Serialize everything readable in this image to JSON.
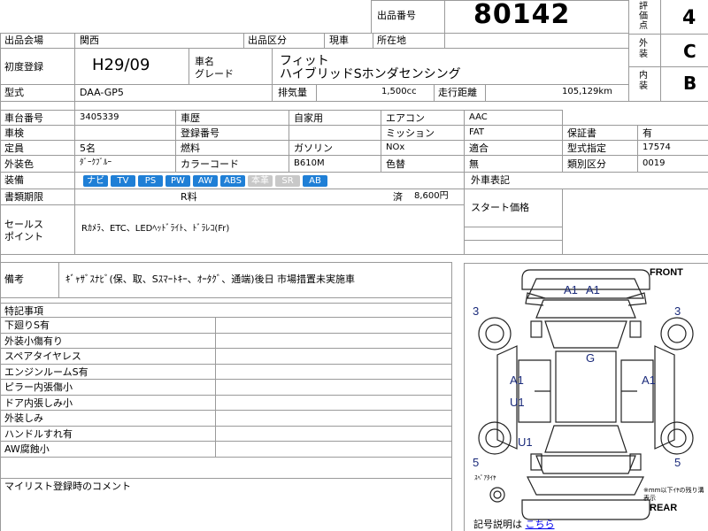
{
  "header": {
    "lot_label": "出品番号",
    "lot_number": "80142",
    "grade_label": "評価点",
    "grade": "4",
    "exterior_label": "外装",
    "exterior_grade": "C",
    "interior_label": "内装",
    "interior_grade": "B"
  },
  "row1": {
    "venue_label": "出品会場",
    "venue": "関西",
    "category_label": "出品区分",
    "category": "現車",
    "location_label": "所在地",
    "location": ""
  },
  "row2": {
    "first_reg_label": "初度登録",
    "first_reg": "H29/09",
    "name_label_1": "車名",
    "name_label_2": "グレード",
    "car_name": "フィット",
    "car_grade": "ハイブリッドSホンダセンシング"
  },
  "row3": {
    "model_label": "型式",
    "model": "DAA-GP5",
    "displacement_label": "排気量",
    "displacement": "1,500cc",
    "mileage_label": "走行距離",
    "mileage": "105,129km"
  },
  "specs": {
    "chassis_label": "車台番号",
    "chassis": "3405339",
    "history_label": "車歴",
    "history": "自家用",
    "ac_label": "エアコン",
    "ac": "AAC",
    "inspection_label": "車検",
    "inspection": "",
    "regno_label": "登録番号",
    "regno": "",
    "mission_label": "ミッション",
    "mission": "FAT",
    "warranty_label": "保証書",
    "warranty": "有",
    "capacity_label": "定員",
    "capacity": "5名",
    "fuel_label": "燃料",
    "fuel": "ガソリン",
    "nox_label": "NOx",
    "nox": "適合",
    "typecert_label": "型式指定",
    "typecert": "17574",
    "color_label": "外装色",
    "color": "ﾀﾞｰｸﾌﾞﾙｰ",
    "colorcode_label": "カラーコード",
    "colorcode": "B610M",
    "repaint_label": "色替",
    "repaint": "無",
    "class_label": "類別区分",
    "class": "0019",
    "equip_label": "装備",
    "equipment": [
      {
        "label": "ナビ",
        "on": true
      },
      {
        "label": "TV",
        "on": true
      },
      {
        "label": "PS",
        "on": true
      },
      {
        "label": "PW",
        "on": true
      },
      {
        "label": "AW",
        "on": true
      },
      {
        "label": "ABS",
        "on": true
      },
      {
        "label": "本革",
        "on": false
      },
      {
        "label": "SR",
        "on": false
      },
      {
        "label": "AB",
        "on": true
      }
    ],
    "docs_label": "書類期限",
    "recycle_label": "R料",
    "recycle_status": "済",
    "recycle_fee": "8,600円",
    "ext_label": "外車表記",
    "start_price_label": "スタート価格"
  },
  "sales": {
    "label_1": "セールス",
    "label_2": "ポイント",
    "text": "Rｶﾒﾗ、ETC、LEDﾍｯﾄﾞﾗｲﾄ、ﾄﾞﾗﾚｺ(Fr)"
  },
  "notes": {
    "label": "備考",
    "text": "ｷﾞｬｻﾞｽﾅﾋﾞ(保、取、Sｽﾏｰﾄｷｰ、ｵｰﾀｸﾞ、通端)後日 市場措置未実施車"
  },
  "special": {
    "label": "特記事項",
    "items": [
      "下廻りS有",
      "外装小傷有り",
      "スペアタイヤレス",
      "エンジンルームS有",
      "ピラー内張傷小",
      "ドア内張しみ小",
      "外装しみ",
      "ハンドルすれ有",
      "AW腐蝕小"
    ]
  },
  "comment_label": "マイリスト登録時のコメント",
  "diagram": {
    "front": "FRONT",
    "rear": "REAR",
    "marks": {
      "roof_a1a": "A1",
      "roof_a1b": "A1",
      "glass": "G",
      "left_a1": "A1",
      "left_u1": "U1",
      "left_u1b": "U1",
      "right_a1": "A1",
      "tire_fl": "3",
      "tire_fr": "3",
      "tire_rl": "5",
      "tire_rr": "5"
    },
    "spare": "ｽﾍﾟｱﾀｲﾔ",
    "tire_note": "※mm以下ｲﾔの残り溝表示",
    "legend_label": "記号説明は",
    "legend_link": "こちら"
  }
}
